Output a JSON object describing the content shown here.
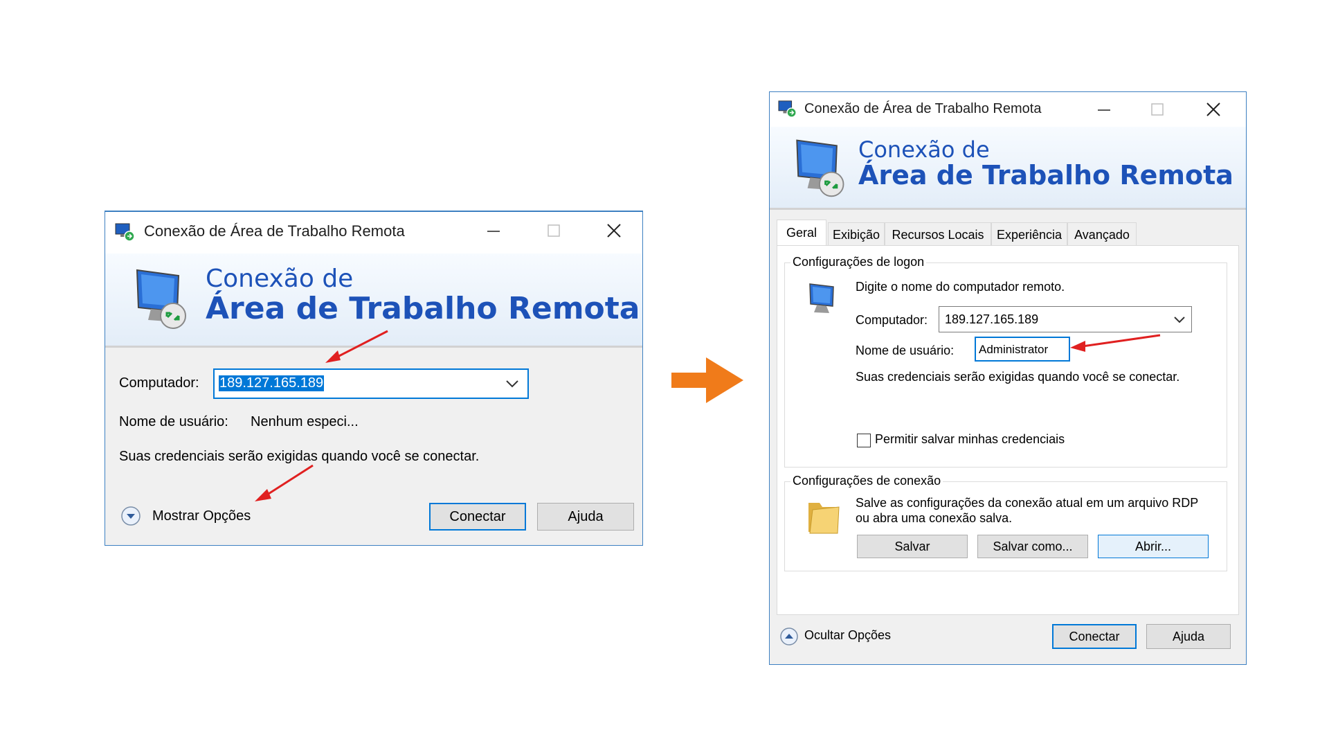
{
  "left_dialog": {
    "title": "Conexão de Área de Trabalho Remota",
    "banner_line1": "Conexão de",
    "banner_line2": "Área de Trabalho Remota",
    "computer_label": "Computador:",
    "computer_value": "189.127.165.189",
    "username_label": "Nome de usuário:",
    "username_value": "Nenhum especi...",
    "credentials_note": "Suas credenciais serão exigidas quando você se conectar.",
    "options_toggle": "Mostrar Opções",
    "connect_button": "Conectar",
    "help_button": "Ajuda"
  },
  "right_dialog": {
    "title": "Conexão de Área de Trabalho Remota",
    "banner_line1": "Conexão de",
    "banner_line2": "Área de Trabalho Remota",
    "tabs": [
      "Geral",
      "Exibição",
      "Recursos Locais",
      "Experiência",
      "Avançado"
    ],
    "logon_group_title": "Configurações de logon",
    "logon_hint": "Digite o nome do computador remoto.",
    "computer_label": "Computador:",
    "computer_value": "189.127.165.189",
    "username_label": "Nome de usuário:",
    "username_value": "Administrator",
    "credentials_note": "Suas credenciais serão exigidas quando você se conectar.",
    "save_credentials_label": "Permitir salvar minhas credenciais",
    "save_credentials_checked": false,
    "connection_group_title": "Configurações de conexão",
    "connection_hint_line1": "Salve as configurações da conexão atual em um arquivo RDP",
    "connection_hint_line2": "ou abra uma conexão salva.",
    "save_button": "Salvar",
    "save_as_button": "Salvar como...",
    "open_button": "Abrir...",
    "options_toggle": "Ocultar Opções",
    "connect_button": "Conectar",
    "help_button": "Ajuda"
  },
  "colors": {
    "banner_text": "#1d52b8",
    "annotation_arrow": "#e02020",
    "transition_arrow": "#f07b1a",
    "focus_border": "#0078d7",
    "selection": "#0078d7"
  },
  "icons": {
    "window": "remote-desktop-icon",
    "minimize": "minimize-icon",
    "maximize": "maximize-icon",
    "close": "close-icon",
    "dropdown": "chevron-down-icon",
    "expand": "expand-options-icon",
    "collapse": "collapse-options-icon",
    "computer": "computer-icon",
    "folder": "folder-icon",
    "transition": "orange-arrow-icon"
  }
}
